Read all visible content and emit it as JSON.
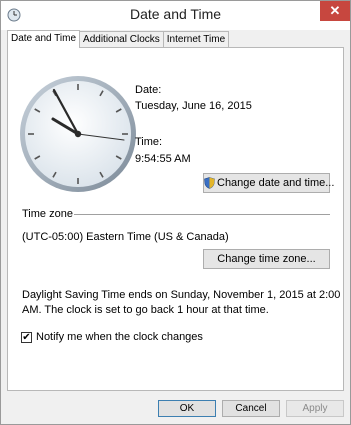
{
  "window": {
    "title": "Date and Time",
    "close_glyph": "✕"
  },
  "tabs": [
    {
      "label": "Date and Time",
      "active": true
    },
    {
      "label": "Additional Clocks",
      "active": false
    },
    {
      "label": "Internet Time",
      "active": false
    }
  ],
  "datetime": {
    "date_label": "Date:",
    "date_value": "Tuesday, June 16, 2015",
    "time_label": "Time:",
    "time_value": "9:54:55 AM",
    "change_button": "Change date and time..."
  },
  "timezone": {
    "section_label": "Time zone",
    "value": "(UTC-05:00) Eastern Time (US & Canada)",
    "change_button": "Change time zone..."
  },
  "dst": {
    "line1": "Daylight Saving Time ends on Sunday, November 1, 2015 at 2:00",
    "line2": "AM. The clock is set to go back 1 hour at that time."
  },
  "notify": {
    "checked": true,
    "check_glyph": "✔",
    "label": "Notify me when the clock changes"
  },
  "buttons": {
    "ok": "OK",
    "cancel": "Cancel",
    "apply": "Apply"
  },
  "colors": {
    "close": "#c7473f",
    "accent": "#3c7fb1"
  }
}
